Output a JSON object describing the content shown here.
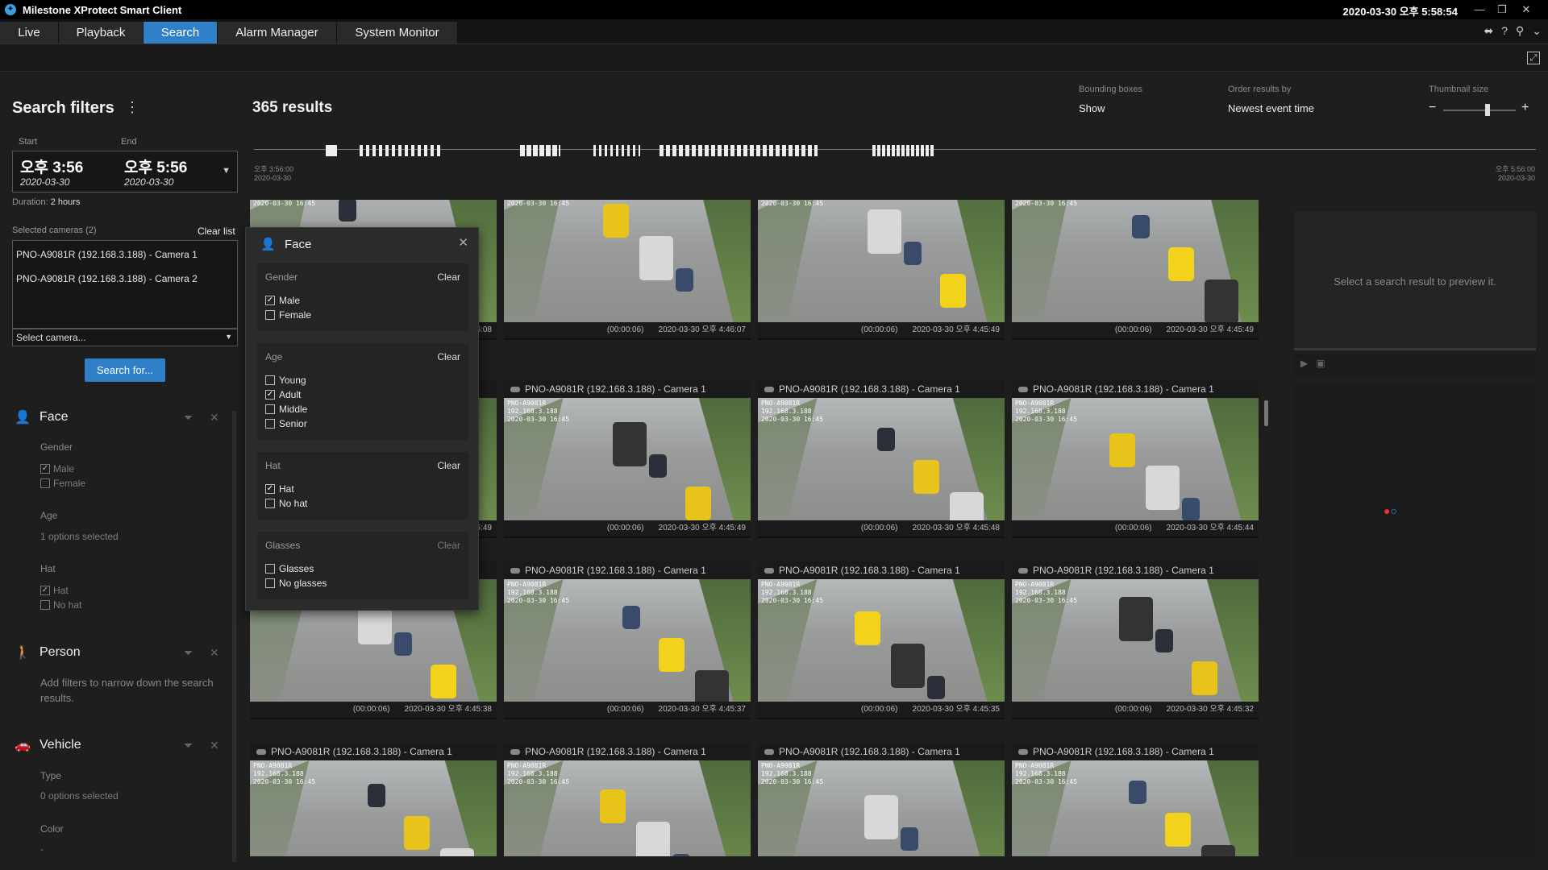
{
  "window": {
    "title": "Milestone XProtect Smart Client",
    "clock": "2020-03-30 오후 5:58:54"
  },
  "tabs": [
    "Live",
    "Playback",
    "Search",
    "Alarm Manager",
    "System Monitor"
  ],
  "filters": {
    "title": "Search filters",
    "start_label": "Start",
    "end_label": "End",
    "start_time": "오후 3:56",
    "start_date": "2020-03-30",
    "end_time": "오후 5:56",
    "end_date": "2020-03-30",
    "duration_label": "Duration:",
    "duration": "2 hours",
    "selected_cameras_label": "Selected cameras (2)",
    "clear_list": "Clear list",
    "cameras": [
      "PNO-A9081R (192.168.3.188) - Camera 1",
      "PNO-A9081R (192.168.3.188) - Camera 2"
    ],
    "select_camera": "Select camera...",
    "search_button": "Search for..."
  },
  "face_section": {
    "title": "Face",
    "gender_label": "Gender",
    "male": "Male",
    "female": "Female",
    "age_label": "Age",
    "age_value": "1 options selected",
    "hat_label": "Hat",
    "hat": "Hat",
    "no_hat": "No hat"
  },
  "person_section": {
    "title": "Person",
    "hint": "Add filters to narrow down the search results."
  },
  "vehicle_section": {
    "title": "Vehicle",
    "type_label": "Type",
    "type_value": "0 options selected",
    "color_label": "Color",
    "color_value": "-"
  },
  "popup": {
    "title": "Face",
    "clear": "Clear",
    "gender": {
      "label": "Gender",
      "options": [
        "Male",
        "Female"
      ],
      "checked": [
        true,
        false
      ]
    },
    "age": {
      "label": "Age",
      "options": [
        "Young",
        "Adult",
        "Middle",
        "Senior"
      ],
      "checked": [
        false,
        true,
        false,
        false
      ]
    },
    "hat": {
      "label": "Hat",
      "options": [
        "Hat",
        "No hat"
      ],
      "checked": [
        true,
        false
      ]
    },
    "glasses": {
      "label": "Glasses",
      "options": [
        "Glasses",
        "No glasses"
      ],
      "checked": [
        false,
        false
      ]
    }
  },
  "results": {
    "count": "365 results",
    "bounding_label": "Bounding boxes",
    "bounding_value": "Show",
    "order_label": "Order results by",
    "order_value": "Newest event time",
    "thumb_label": "Thumbnail size",
    "timeline_start_time": "오후 3:56:00",
    "timeline_start_date": "2020-03-30",
    "timeline_end_time": "오후 5:56:00",
    "timeline_end_date": "2020-03-30",
    "camera_name": "PNO-A9081R (192.168.3.188) - Camera 1",
    "overlay_text": "PNO-A9081R\n192.168.3.188\n2020-03-30 16:45",
    "cards": [
      {
        "header": "",
        "dur": "(00:00:06)",
        "ts": "2020-03-30 오후 4:46:08"
      },
      {
        "header": "",
        "dur": "(00:00:06)",
        "ts": "2020-03-30 오후 4:46:07"
      },
      {
        "header": "",
        "dur": "(00:00:06)",
        "ts": "2020-03-30 오후 4:45:49"
      },
      {
        "header": "",
        "dur": "(00:00:06)",
        "ts": "2020-03-30 오후 4:45:49"
      },
      {
        "header": "PNO-A9081R (192.168.3.188) - Camera 1",
        "dur": "(00:00:06)",
        "ts": "2020-03-30 오후 4:45:49"
      },
      {
        "header": "PNO-A9081R (192.168.3.188) - Camera 1",
        "dur": "(00:00:06)",
        "ts": "2020-03-30 오후 4:45:49"
      },
      {
        "header": "PNO-A9081R (192.168.3.188) - Camera 1",
        "dur": "(00:00:06)",
        "ts": "2020-03-30 오후 4:45:48"
      },
      {
        "header": "PNO-A9081R (192.168.3.188) - Camera 1",
        "dur": "(00:00:06)",
        "ts": "2020-03-30 오후 4:45:44"
      },
      {
        "header": "PNO-A9081R (192.168.3.188) - Camera 1",
        "dur": "(00:00:06)",
        "ts": "2020-03-30 오후 4:45:38"
      },
      {
        "header": "PNO-A9081R (192.168.3.188) - Camera 1",
        "dur": "(00:00:06)",
        "ts": "2020-03-30 오후 4:45:37"
      },
      {
        "header": "PNO-A9081R (192.168.3.188) - Camera 1",
        "dur": "(00:00:06)",
        "ts": "2020-03-30 오후 4:45:35"
      },
      {
        "header": "PNO-A9081R (192.168.3.188) - Camera 1",
        "dur": "(00:00:06)",
        "ts": "2020-03-30 오후 4:45:32"
      },
      {
        "header": "PNO-A9081R (192.168.3.188) - Camera 1",
        "dur": "",
        "ts": ""
      },
      {
        "header": "PNO-A9081R (192.168.3.188) - Camera 1",
        "dur": "",
        "ts": ""
      },
      {
        "header": "PNO-A9081R (192.168.3.188) - Camera 1",
        "dur": "",
        "ts": ""
      },
      {
        "header": "PNO-A9081R (192.168.3.188) - Camera 1",
        "dur": "",
        "ts": ""
      }
    ]
  },
  "preview": {
    "hint": "Select a search result to preview it."
  },
  "icons": {
    "app": "milestone-logo-icon",
    "filter": "funnel-icon",
    "remove": "close-icon",
    "person": "person-icon",
    "vehicle": "car-icon"
  },
  "colors": {
    "accent": "#2f80c8",
    "background": "#1e1e1e"
  }
}
